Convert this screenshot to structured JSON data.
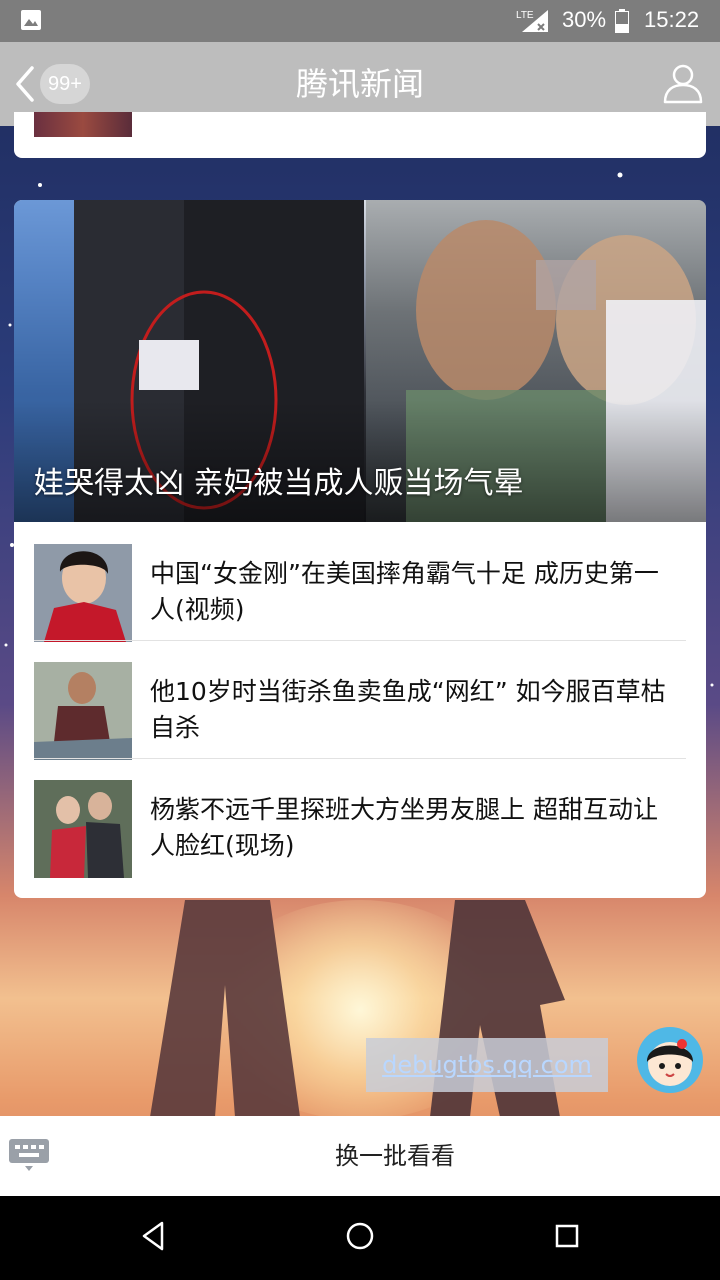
{
  "status_bar": {
    "signal_label": "LTE",
    "battery_percent": "30%",
    "time": "15:22"
  },
  "header": {
    "badge": "99+",
    "title": "腾讯新闻"
  },
  "hero": {
    "caption": "娃哭得太凶 亲妈被当成人贩当场气晕"
  },
  "news_items": [
    {
      "title": "中国“女金刚”在美国摔角霸气十足 成历史第一人(视频)"
    },
    {
      "title": "他10岁时当街杀鱼卖鱼成“网红” 如今服百草枯自杀"
    },
    {
      "title": "杨紫不远千里探班大方坐男友腿上 超甜互动让人脸红(现场)"
    }
  ],
  "debug_link": "debugtbs.qq.com",
  "bottom": {
    "refresh_label": "换一批看看"
  }
}
